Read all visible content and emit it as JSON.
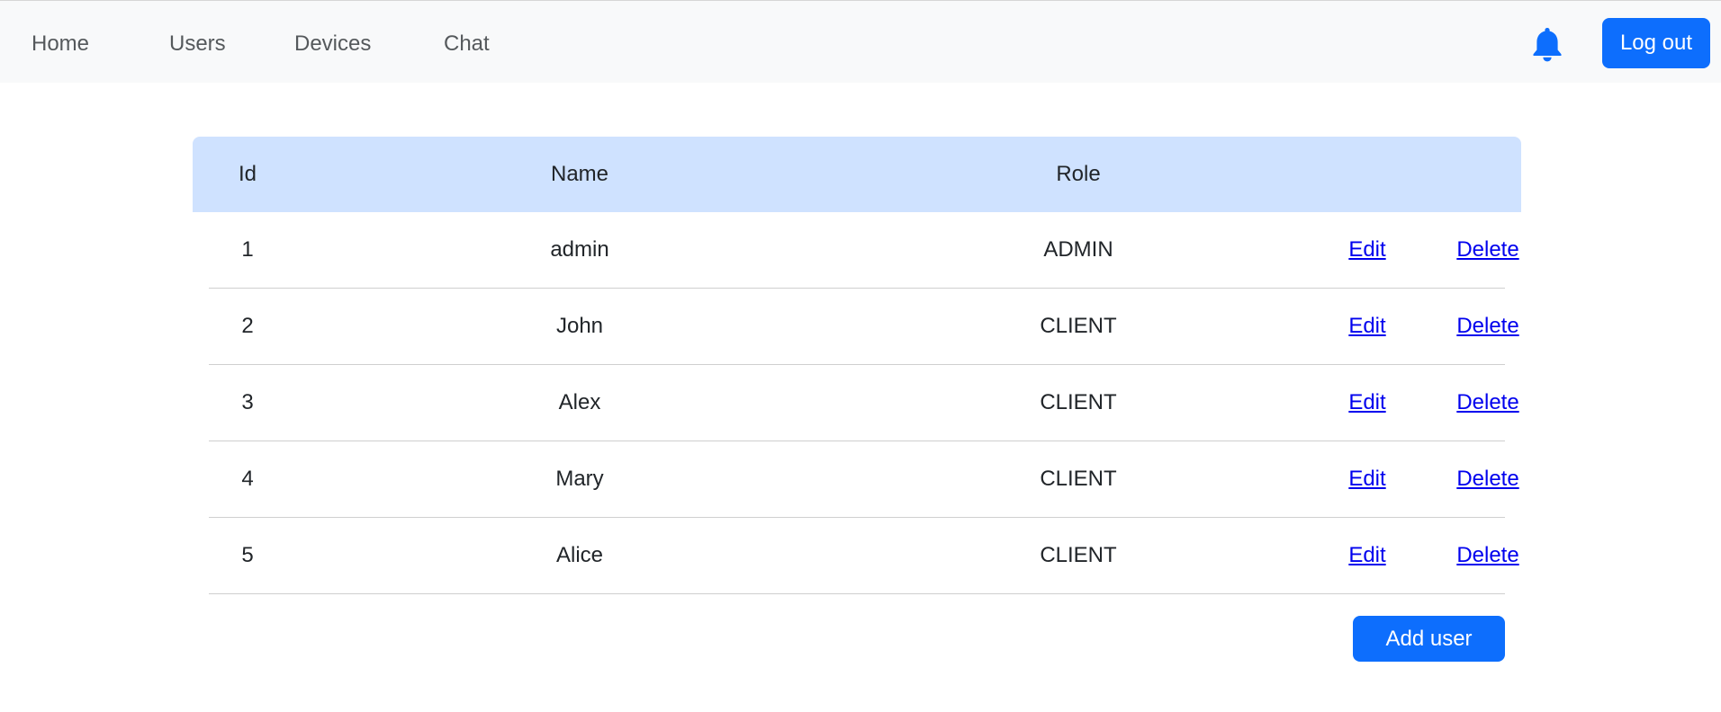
{
  "nav": {
    "links": [
      "Home",
      "Users",
      "Devices",
      "Chat"
    ],
    "logout_label": "Log out",
    "bell_icon": "bell-icon"
  },
  "table": {
    "headers": [
      "Id",
      "Name",
      "Role",
      "",
      ""
    ],
    "rows": [
      {
        "id": "1",
        "name": "admin",
        "role": "ADMIN",
        "edit": "Edit",
        "delete": "Delete"
      },
      {
        "id": "2",
        "name": "John",
        "role": "CLIENT",
        "edit": "Edit",
        "delete": "Delete"
      },
      {
        "id": "3",
        "name": "Alex",
        "role": "CLIENT",
        "edit": "Edit",
        "delete": "Delete"
      },
      {
        "id": "4",
        "name": "Mary",
        "role": "CLIENT",
        "edit": "Edit",
        "delete": "Delete"
      },
      {
        "id": "5",
        "name": "Alice",
        "role": "CLIENT",
        "edit": "Edit",
        "delete": "Delete"
      }
    ]
  },
  "add_user_label": "Add user",
  "colors": {
    "accent": "#0d6efd",
    "header_bg": "#cfe2ff",
    "navbar_bg": "#f8f9fa",
    "link": "#0000ee"
  }
}
